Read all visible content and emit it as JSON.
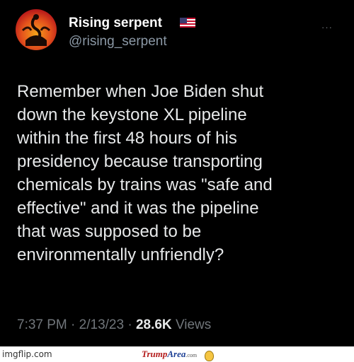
{
  "tweet": {
    "display_name": "Rising serpent",
    "handle": "@rising_serpent",
    "more_label": "···",
    "body_lines": [
      "Remember when Joe Biden shut",
      "down the keystone XL pipeline",
      "within the first 48 hours of his",
      "presidency because transporting",
      "chemicals by trains was \"safe and",
      "effective\" and it was the pipeline",
      "that was supposed to be",
      "environmentally unfriendly?"
    ],
    "time": "7:37 PM",
    "date": "2/13/23",
    "separator": "·",
    "views_count": "28.6K",
    "views_label": "Views"
  },
  "footer": {
    "imgflip": "imgflip.com",
    "trumparea_trump": "Trump",
    "trumparea_area": "Area",
    "trumparea_com": ".com"
  },
  "icons": {
    "avatar": "serpent-avatar",
    "flag": "us-flag-icon",
    "more": "more-options-icon"
  },
  "colors": {
    "background": "#000000",
    "primary_text": "#e7e9ea",
    "secondary_text": "#71767b"
  }
}
